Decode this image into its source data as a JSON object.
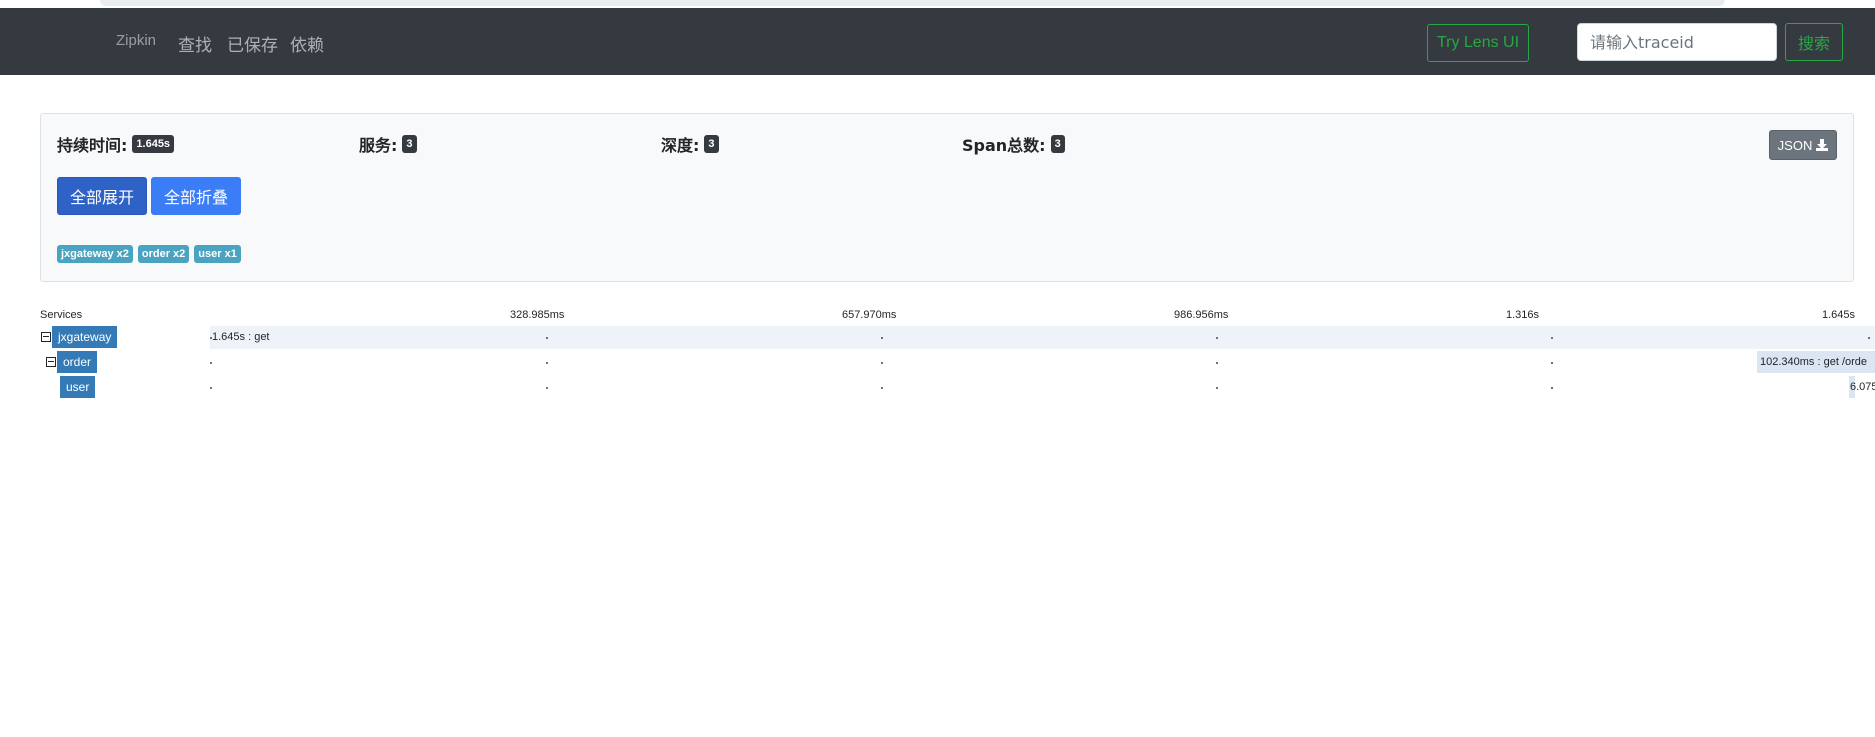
{
  "navbar": {
    "brand": "Zipkin",
    "links": [
      {
        "label": "查找"
      },
      {
        "label": "已保存"
      },
      {
        "label": "依赖"
      }
    ],
    "lens_button": "Try Lens UI",
    "search_placeholder": "请输入traceid",
    "search_button": "搜索"
  },
  "summary": {
    "duration_label": "持续时间:",
    "duration_value": "1.645s",
    "services_label": "服务:",
    "services_value": "3",
    "depth_label": "深度:",
    "depth_value": "3",
    "spans_label": "Span总数:",
    "spans_value": "3",
    "json_button": "JSON",
    "expand_all": "全部展开",
    "collapse_all": "全部折叠",
    "service_badges": [
      "jxgateway x2",
      "order x2",
      "user x1"
    ]
  },
  "timeline": {
    "services_header": "Services",
    "ticks": [
      "328.985ms",
      "657.970ms",
      "986.956ms",
      "1.316s",
      "1.645s"
    ],
    "rows": [
      {
        "service": "jxgateway",
        "span": "1.645s : get"
      },
      {
        "service": "order",
        "span": "102.340ms : get /orde"
      },
      {
        "service": "user",
        "span": "6.075"
      }
    ]
  }
}
